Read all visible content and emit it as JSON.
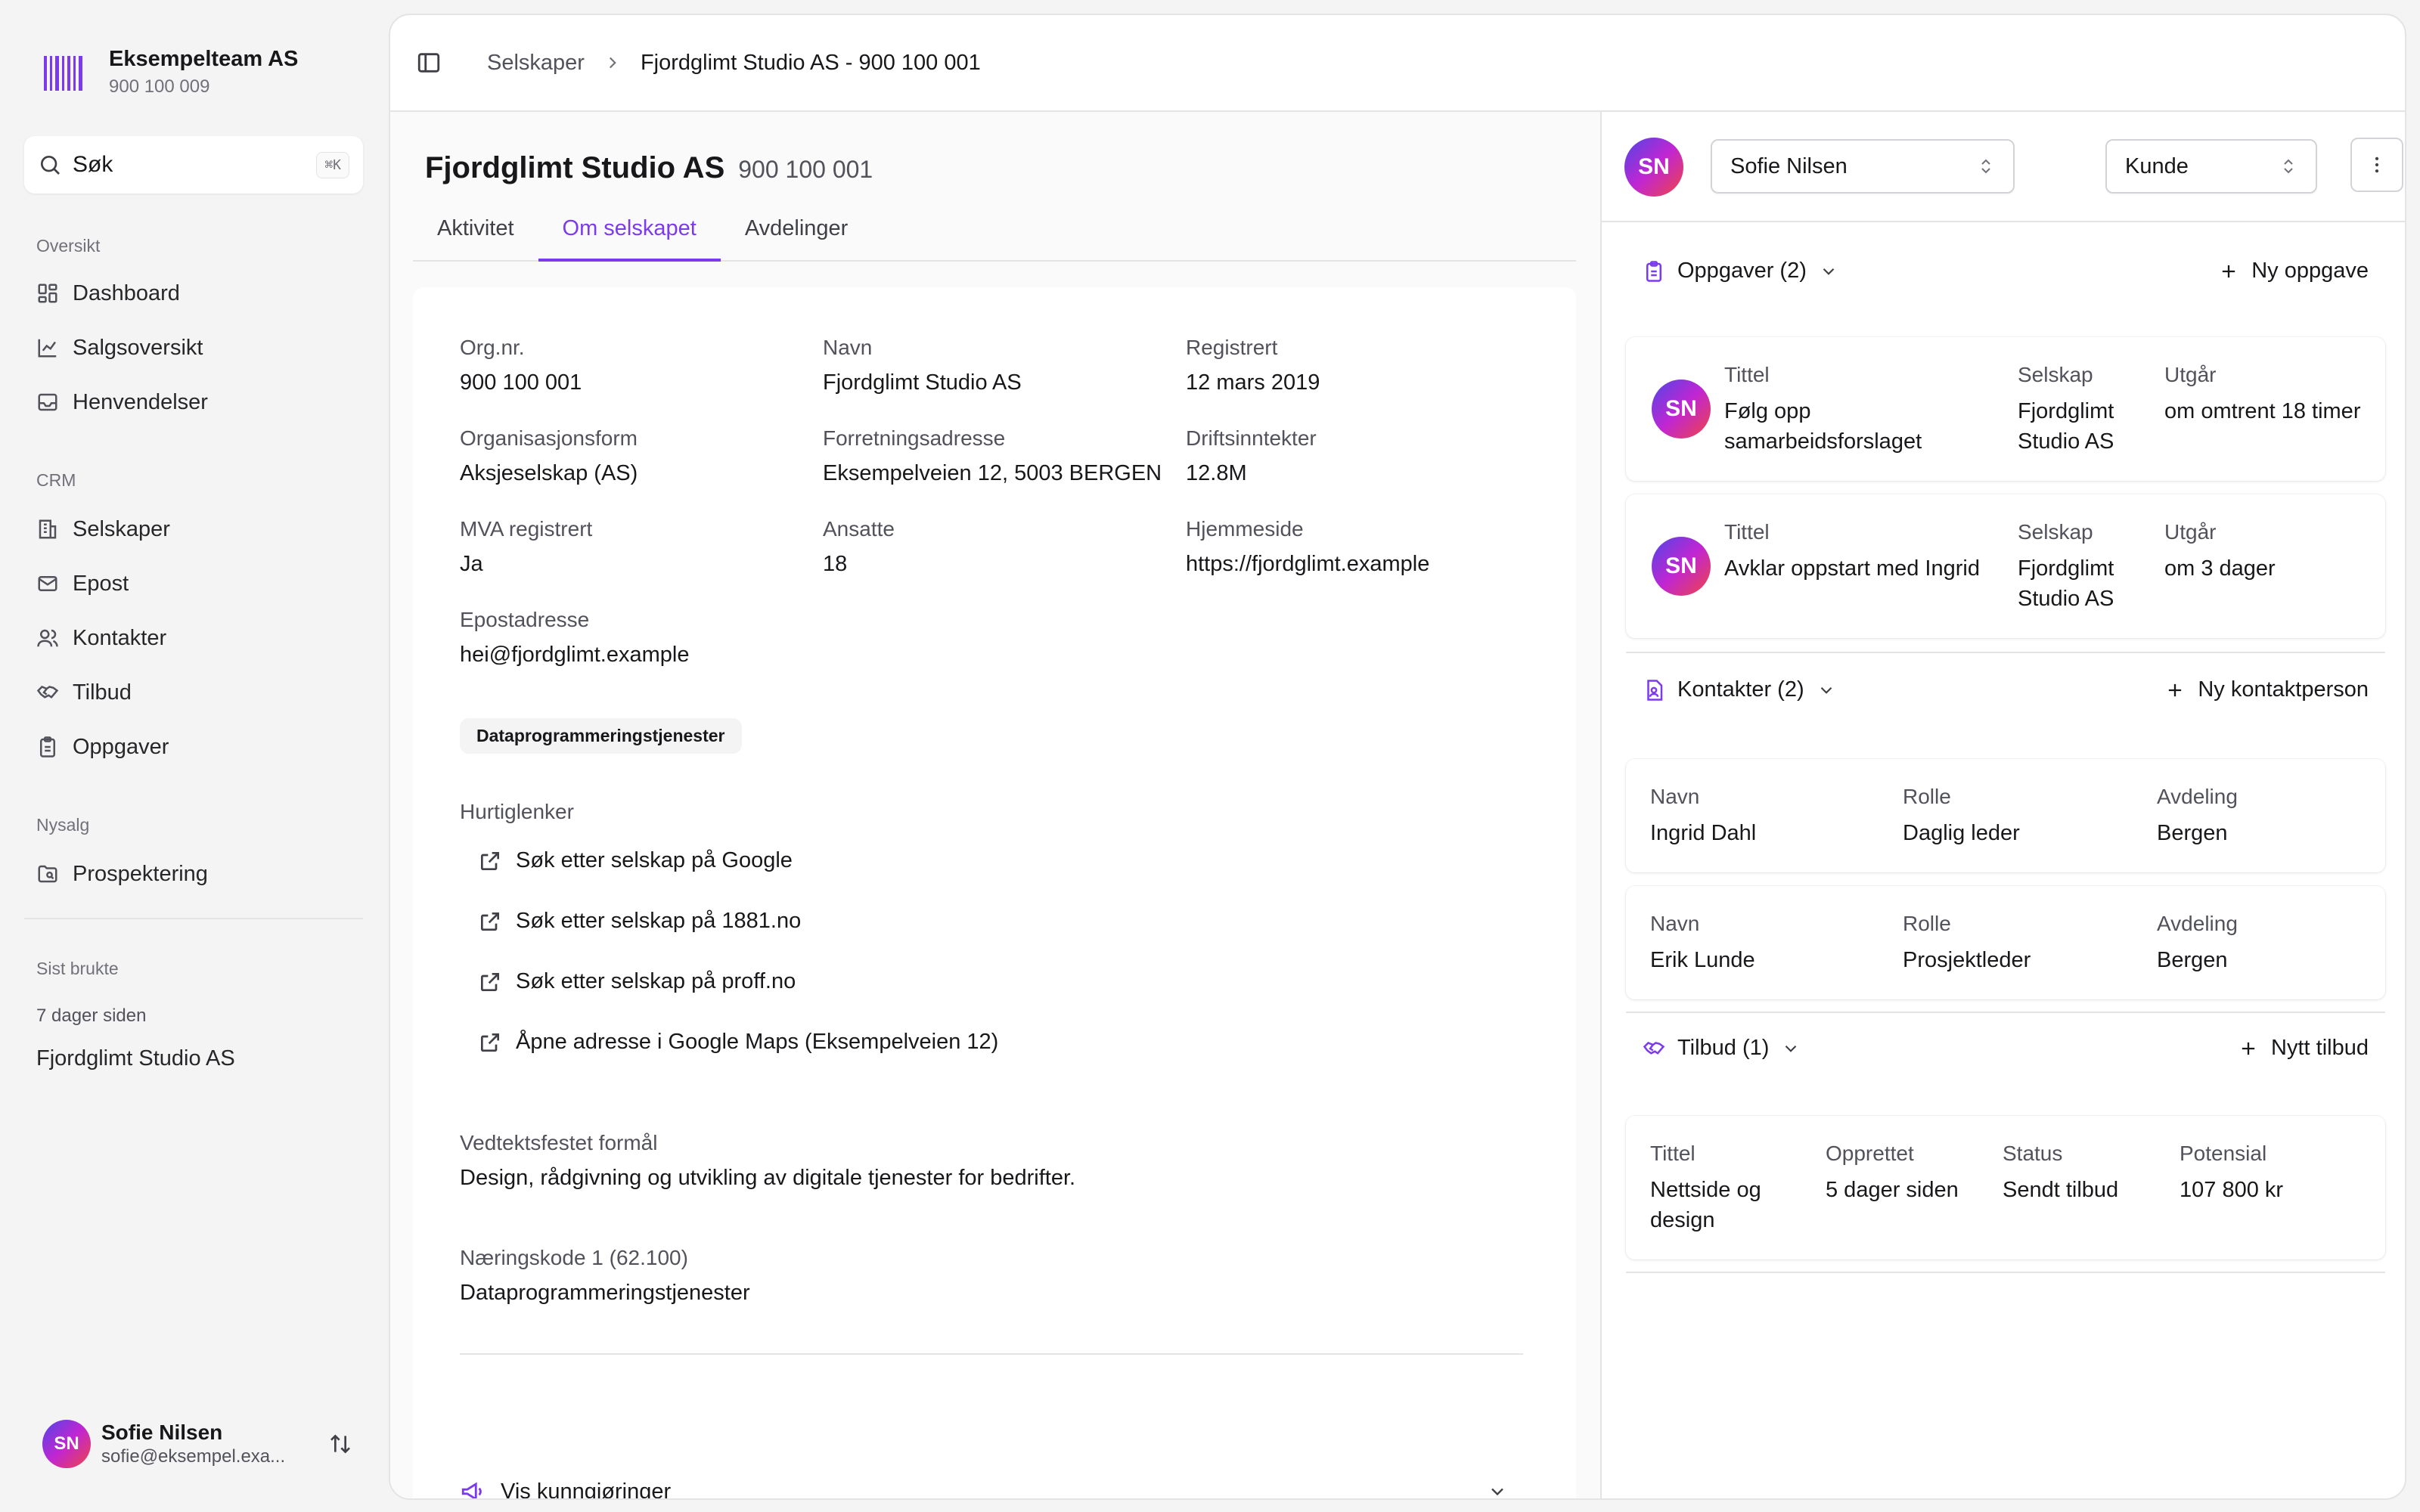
{
  "team": {
    "name": "Eksempelteam AS",
    "org": "900 100 009"
  },
  "search": {
    "label": "Søk",
    "shortcut": "⌘K"
  },
  "nav": {
    "groups": [
      {
        "label": "Oversikt",
        "items": [
          "Dashboard",
          "Salgsoversikt",
          "Henvendelser"
        ]
      },
      {
        "label": "CRM",
        "items": [
          "Selskaper",
          "Epost",
          "Kontakter",
          "Tilbud",
          "Oppgaver"
        ]
      },
      {
        "label": "Nysalg",
        "items": [
          "Prospektering"
        ]
      }
    ],
    "recent": {
      "label": "Sist brukte",
      "time": "7 dager siden",
      "item": "Fjordglimt Studio AS"
    }
  },
  "user": {
    "initials": "SN",
    "name": "Sofie Nilsen",
    "email": "sofie@eksempel.exa..."
  },
  "breadcrumb": {
    "root": "Selskaper",
    "current": "Fjordglimt Studio AS - 900 100 001"
  },
  "company": {
    "name": "Fjordglimt Studio AS",
    "org": "900 100 001",
    "tabs": [
      "Aktivitet",
      "Om selskapet",
      "Avdelinger"
    ],
    "fields": {
      "orgnr": {
        "label": "Org.nr.",
        "value": "900 100 001"
      },
      "navn": {
        "label": "Navn",
        "value": "Fjordglimt Studio AS"
      },
      "registrert": {
        "label": "Registrert",
        "value": "12 mars 2019"
      },
      "orgform": {
        "label": "Organisasjonsform",
        "value": "Aksjeselskap (AS)"
      },
      "adresse": {
        "label": "Forretningsadresse",
        "value": "Eksempelveien 12, 5003 BERGEN"
      },
      "drift": {
        "label": "Driftsinntekter",
        "value": "12.8M"
      },
      "mva": {
        "label": "MVA registrert",
        "value": "Ja"
      },
      "ansatte": {
        "label": "Ansatte",
        "value": "18"
      },
      "hjemmeside": {
        "label": "Hjemmeside",
        "value": "https://fjordglimt.example"
      },
      "epost": {
        "label": "Epostadresse",
        "value": "hei@fjordglimt.example"
      }
    },
    "tag": "Dataprogrammeringstjenester",
    "quicklinks": {
      "title": "Hurtiglenker",
      "items": [
        "Søk etter selskap på Google",
        "Søk etter selskap på 1881.no",
        "Søk etter selskap på proff.no",
        "Åpne adresse i Google Maps (Eksempelveien 12)"
      ]
    },
    "purpose": {
      "label": "Vedtektsfestet formål",
      "value": "Design, rådgivning og utvikling av digitale tjenester for bedrifter."
    },
    "naering": {
      "label": "Næringskode 1 (62.100)",
      "value": "Dataprogrammeringstjenester"
    },
    "announcements": "Vis kunngjøringer"
  },
  "panel": {
    "owner": {
      "initials": "SN",
      "name": "Sofie Nilsen"
    },
    "status": "Kunde",
    "tasks": {
      "title": "Oppgaver (2)",
      "action": "Ny oppgave",
      "items": [
        {
          "initials": "SN",
          "title_label": "Tittel",
          "title": "Følg opp samarbeidsforslaget",
          "company_label": "Selskap",
          "company": "Fjordglimt Studio AS",
          "due_label": "Utgår",
          "due": "om omtrent 18 timer"
        },
        {
          "initials": "SN",
          "title_label": "Tittel",
          "title": "Avklar oppstart med Ingrid",
          "company_label": "Selskap",
          "company": "Fjordglimt Studio AS",
          "due_label": "Utgår",
          "due": "om 3 dager"
        }
      ]
    },
    "contacts": {
      "title": "Kontakter (2)",
      "action": "Ny kontaktperson",
      "items": [
        {
          "name_label": "Navn",
          "name": "Ingrid Dahl",
          "role_label": "Rolle",
          "role": "Daglig leder",
          "dept_label": "Avdeling",
          "dept": "Bergen"
        },
        {
          "name_label": "Navn",
          "name": "Erik Lunde",
          "role_label": "Rolle",
          "role": "Prosjektleder",
          "dept_label": "Avdeling",
          "dept": "Bergen"
        }
      ]
    },
    "offers": {
      "title": "Tilbud (1)",
      "action": "Nytt tilbud",
      "items": [
        {
          "title_label": "Tittel",
          "title": "Nettside og design",
          "created_label": "Opprettet",
          "created": "5 dager siden",
          "status_label": "Status",
          "status": "Sendt tilbud",
          "potential_label": "Potensial",
          "potential": "107 800 kr"
        }
      ]
    }
  },
  "colors": {
    "accent": "#7c3aed",
    "border": "#e4e4e7",
    "muted": "#52525b"
  }
}
